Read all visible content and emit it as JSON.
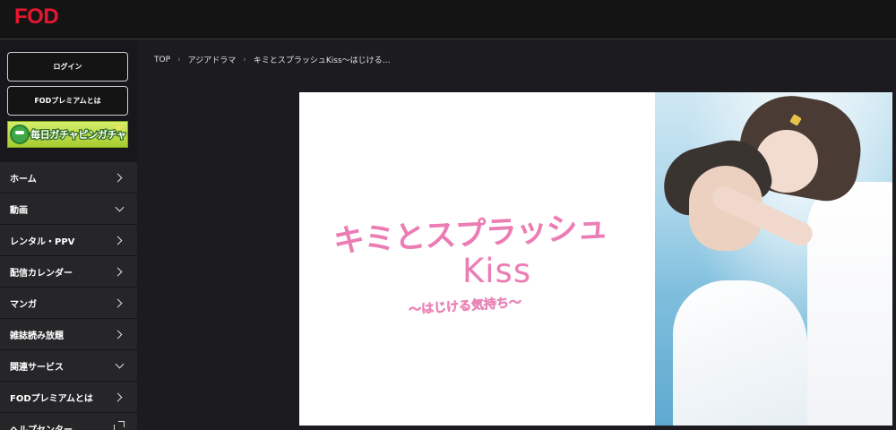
{
  "brand": {
    "logo": "FOD"
  },
  "sidebar": {
    "login_label": "ログイン",
    "premium_label": "FODプレミアムとは",
    "banner_text": "毎日ガチャピンガチャ",
    "menu": [
      {
        "label": "ホーム",
        "icon": "chevron-right-icon"
      },
      {
        "label": "動画",
        "icon": "chevron-down-icon"
      },
      {
        "label": "レンタル・PPV",
        "icon": "chevron-right-icon"
      },
      {
        "label": "配信カレンダー",
        "icon": "chevron-right-icon"
      },
      {
        "label": "マンガ",
        "icon": "chevron-right-icon"
      },
      {
        "label": "雑誌読み放題",
        "icon": "chevron-right-icon"
      },
      {
        "label": "関連サービス",
        "icon": "chevron-down-icon"
      },
      {
        "label": "FODプレミアムとは",
        "icon": "chevron-right-icon"
      },
      {
        "label": "ヘルプセンター",
        "icon": "external-link-icon"
      }
    ]
  },
  "breadcrumb": {
    "items": [
      "TOP",
      "アジアドラマ",
      "キミとスプラッシュKiss〜はじける…"
    ]
  },
  "hero": {
    "title_line1": "キミとスプラッシュ",
    "title_line2": "Kiss",
    "subtitle": "〜はじける気持ち〜"
  },
  "colors": {
    "brand_red": "#e5172f",
    "page_bg": "#1c1c20",
    "title_pink": "#ec7db4"
  }
}
